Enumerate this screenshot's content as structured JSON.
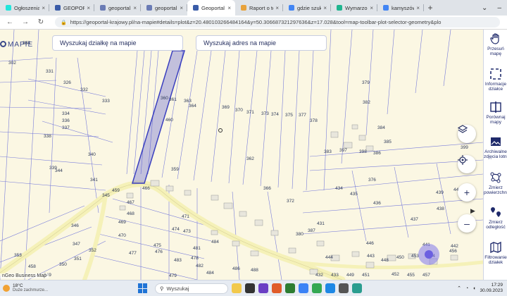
{
  "browser": {
    "tabs": [
      {
        "title": "Ogłoszenia - Sprz",
        "icon": "olx-icon",
        "color": "#23e5db",
        "active": false
      },
      {
        "title": "GEOPORTAL 2",
        "icon": "geoportal-icon",
        "color": "#3a5ca8",
        "active": false
      },
      {
        "title": "geoportal.gov.pl",
        "icon": "globe-icon",
        "color": "#6a7bb5",
        "active": false
      },
      {
        "title": "geoportal - Pocz",
        "icon": "globe-icon",
        "color": "#6a7bb5",
        "active": false
      },
      {
        "title": "Geoportal Kraj",
        "icon": "geoportal-icon",
        "color": "#3a5ca8",
        "active": true
      },
      {
        "title": "Raport o tereni",
        "icon": "document-icon",
        "color": "#e8a23b",
        "active": false
      },
      {
        "title": "gdzie szukać lini",
        "icon": "google-icon",
        "color": "#4285f4",
        "active": false
      },
      {
        "title": "Wymarzona dział",
        "icon": "site-icon",
        "color": "#1fb58f",
        "active": false
      },
      {
        "title": "kamyszów kod p",
        "icon": "google-icon",
        "color": "#4285f4",
        "active": false
      }
    ],
    "url": "https://geoportal-krajowy.pl/na-mapie#details=plot&z=20.480103266484164&y=50.306687321297636&z=17.028&tool=map-toolbar-plot-selector-geometry&plo"
  },
  "map": {
    "logo_text": "MAPIE",
    "search_plot": "Wyszukaj działkę na mapie",
    "search_address": "Wyszukaj adres na mapie",
    "attribution": "nGeo Business Map",
    "parcel_labels": [
      "307",
      "302",
      "331",
      "326",
      "332",
      "333",
      "334",
      "336",
      "337",
      "338",
      "339",
      "340",
      "341",
      "344",
      "345",
      "346",
      "347",
      "466",
      "467",
      "468",
      "469",
      "470",
      "471",
      "473",
      "474",
      "475",
      "476",
      "477",
      "478",
      "479",
      "481",
      "482",
      "483",
      "484",
      "484",
      "486",
      "488",
      "360",
      "361",
      "363",
      "364",
      "369",
      "370",
      "371",
      "373",
      "374",
      "375",
      "377",
      "378",
      "379",
      "383",
      "382",
      "384",
      "385",
      "386",
      "397",
      "398",
      "399",
      "434",
      "435",
      "436",
      "437",
      "438",
      "439",
      "440",
      "441",
      "442",
      "443",
      "444",
      "446",
      "448",
      "450",
      "453",
      "454",
      "456",
      "459",
      "460",
      "359",
      "362",
      "366",
      "372",
      "376",
      "380",
      "387",
      "431",
      "432",
      "433",
      "449",
      "451",
      "452",
      "455",
      "457",
      "458",
      "349",
      "350",
      "351",
      "352",
      "353",
      "354"
    ]
  },
  "sidebar": {
    "tools": [
      {
        "label1": "Przesuń",
        "label2": "mapę",
        "icon": "hand-icon"
      },
      {
        "label1": "Informacje",
        "label2": "działce",
        "icon": "info-select-icon"
      },
      {
        "label1": "Porównaj",
        "label2": "mapy",
        "icon": "compare-icon"
      },
      {
        "label1": "Archiwalne",
        "label2": "zdjęcia lotnicze",
        "icon": "photo-icon"
      },
      {
        "label1": "Zmierz",
        "label2": "powierzchnię",
        "icon": "area-measure-icon"
      },
      {
        "label1": "Zmierz",
        "label2": "odległość",
        "icon": "distance-icon"
      },
      {
        "label1": "Filtrowanie",
        "label2": "działek",
        "icon": "filter-map-icon"
      }
    ]
  },
  "taskbar": {
    "temperature": "18°C",
    "weather_desc": "Duże zachmurze...",
    "search_placeholder": "Wyszukaj",
    "time": "17:29",
    "date": "30.09.2023"
  }
}
